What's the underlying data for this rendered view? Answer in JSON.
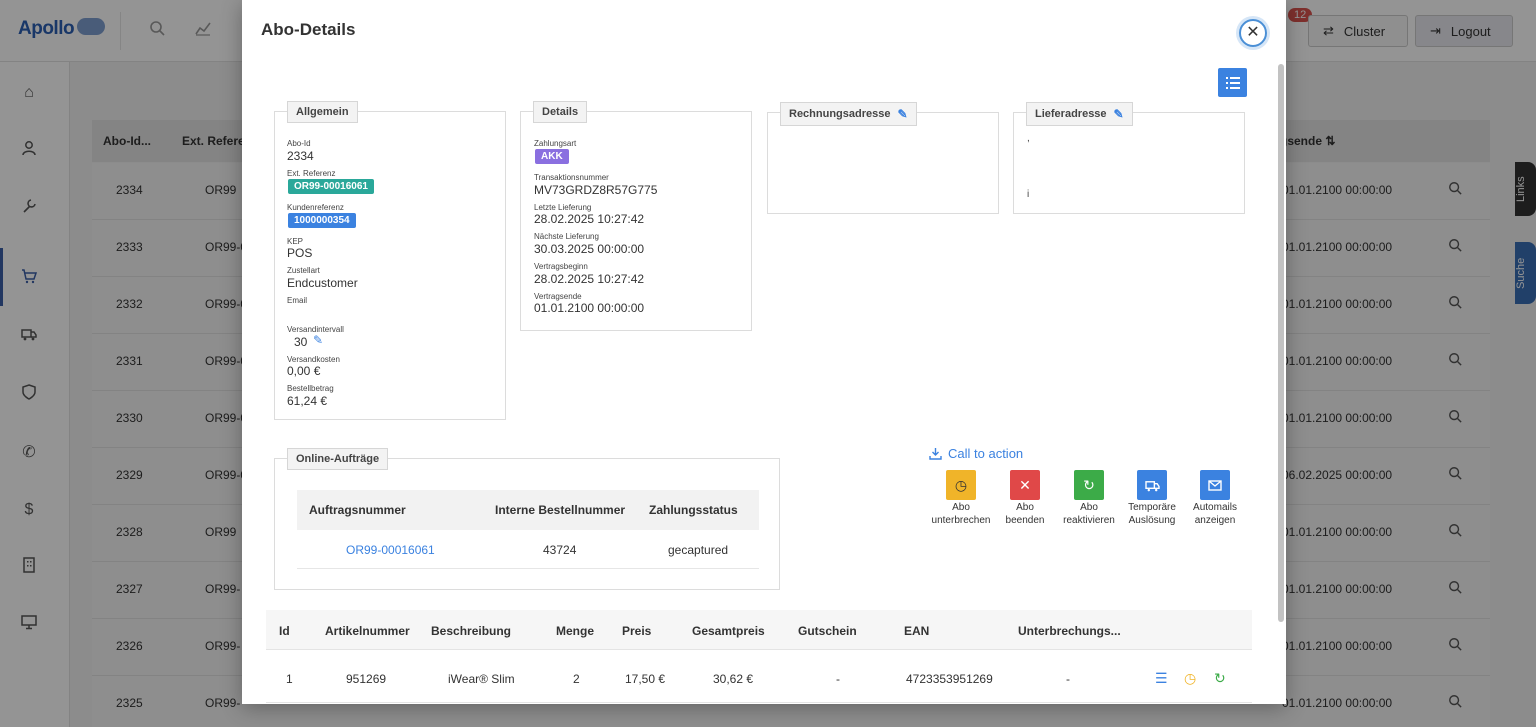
{
  "app": {
    "logo": "Apollo",
    "notification_count": "12",
    "cluster_label": "Cluster",
    "logout_label": "Logout",
    "side_tabs": {
      "links": "Links",
      "suche": "Suche"
    }
  },
  "background_table": {
    "headers": {
      "id": "Abo-Id...",
      "ext": "Ext. Referer",
      "end": "gsende ⇅"
    },
    "rows": [
      {
        "id": "2334",
        "ext": "OR99",
        "end": "01.01.2100 00:00:00"
      },
      {
        "id": "2333",
        "ext": "OR99-0",
        "end": "01.01.2100 00:00:00"
      },
      {
        "id": "2332",
        "ext": "OR99-0",
        "end": "01.01.2100 00:00:00"
      },
      {
        "id": "2331",
        "ext": "OR99-0",
        "end": "01.01.2100 00:00:00"
      },
      {
        "id": "2330",
        "ext": "OR99-0",
        "end": "01.01.2100 00:00:00"
      },
      {
        "id": "2329",
        "ext": "OR99-0",
        "end": "06.02.2025 00:00:00"
      },
      {
        "id": "2328",
        "ext": "OR99",
        "end": "01.01.2100 00:00:00"
      },
      {
        "id": "2327",
        "ext": "OR99-",
        "end": "01.01.2100 00:00:00"
      },
      {
        "id": "2326",
        "ext": "OR99-",
        "end": "01.01.2100 00:00:00"
      },
      {
        "id": "2325",
        "ext": "OR99-",
        "end": "01.01.2100 00:00:00"
      }
    ]
  },
  "modal": {
    "title": "Abo-Details",
    "allgemein": {
      "legend": "Allgemein",
      "abo_id_label": "Abo-Id",
      "abo_id": "2334",
      "ext_ref_label": "Ext. Referenz",
      "ext_ref": "OR99-00016061",
      "kundenref_label": "Kundenreferenz",
      "kundenref": "1000000354",
      "kep_label": "KEP",
      "kep": "POS",
      "zustellart_label": "Zustellart",
      "zustellart": "Endcustomer",
      "email_label": "Email",
      "email": "",
      "intervall_label": "Versandintervall",
      "intervall": "30",
      "versandkosten_label": "Versandkosten",
      "versandkosten": "0,00 €",
      "bestellbetrag_label": "Bestellbetrag",
      "bestellbetrag": "61,24 €"
    },
    "details": {
      "legend": "Details",
      "zahlungsart_label": "Zahlungsart",
      "zahlungsart": "AKK",
      "transaktion_label": "Transaktionsnummer",
      "transaktion": "MV73GRDZ8R57G775",
      "letzte_label": "Letzte Lieferung",
      "letzte": "28.02.2025 10:27:42",
      "naechste_label": "Nächste Lieferung",
      "naechste": "30.03.2025 00:00:00",
      "beginn_label": "Vertragsbeginn",
      "beginn": "28.02.2025 10:27:42",
      "ende_label": "Vertragsende",
      "ende": "01.01.2100 00:00:00"
    },
    "rechnungsadresse": {
      "legend": "Rechnungsadresse"
    },
    "lieferadresse": {
      "legend": "Lieferadresse",
      "line1": ",",
      "line2": "i"
    },
    "online_auftraege": {
      "legend": "Online-Aufträge",
      "headers": [
        "Auftragsnummer",
        "Interne Bestellnummer",
        "Zahlungsstatus"
      ],
      "row": {
        "auftrag": "OR99-00016061",
        "bestellnr": "43724",
        "status": "gecaptured"
      }
    },
    "cta": {
      "title": "Call to action",
      "buttons": [
        {
          "line1": "Abo",
          "line2": "unterbrechen",
          "color": "#f0b429"
        },
        {
          "line1": "Abo",
          "line2": "beenden",
          "color": "#e04848"
        },
        {
          "line1": "Abo",
          "line2": "reaktivieren",
          "color": "#3cab48"
        },
        {
          "line1": "Temporäre",
          "line2": "Auslösung",
          "color": "#3b82e0"
        },
        {
          "line1": "Automails",
          "line2": "anzeigen",
          "color": "#3b82e0"
        }
      ]
    },
    "articles": {
      "headers": [
        "Id",
        "Artikelnummer",
        "Beschreibung",
        "Menge",
        "Preis",
        "Gesamtpreis",
        "Gutschein",
        "EAN",
        "Unterbrechungs..."
      ],
      "row": {
        "id": "1",
        "artikel": "951269",
        "beschreibung": "iWear® Slim",
        "menge": "2",
        "preis": "17,50 €",
        "gesamt": "30,62 €",
        "gutschein": "-",
        "ean": "4723353951269",
        "unterbrechung": "-"
      }
    }
  }
}
